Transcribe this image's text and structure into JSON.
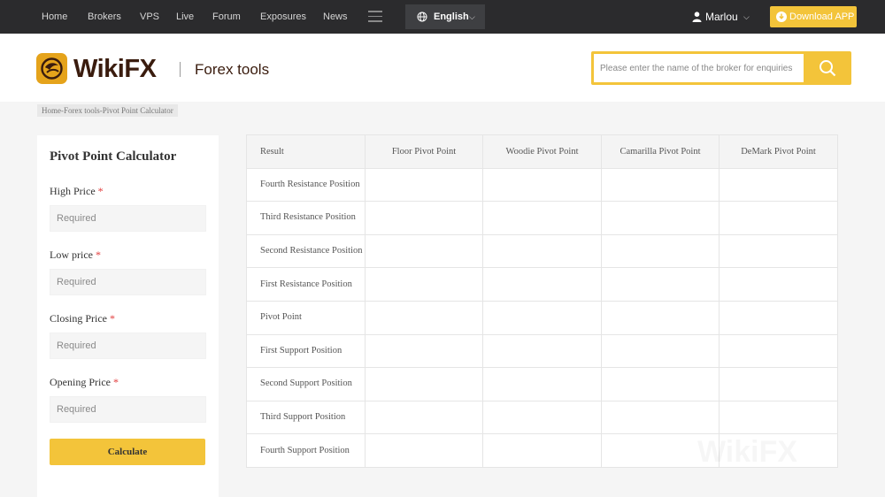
{
  "topnav": {
    "items": [
      "Home",
      "Brokers",
      "VPS",
      "Live",
      "Forum",
      "Exposures",
      "News"
    ],
    "language": "English",
    "user_name": "Marlou",
    "download_label": "Download APP"
  },
  "header": {
    "logo_text": "WikiFX",
    "subtitle": "Forex tools",
    "search_placeholder": "Please enter the name of the broker for enquiries"
  },
  "breadcrumb": "Home-Forex tools-Pivot Point Calculator",
  "form": {
    "title": "Pivot Point Calculator",
    "fields": [
      {
        "label": "High Price",
        "placeholder": "Required"
      },
      {
        "label": "Low price",
        "placeholder": "Required"
      },
      {
        "label": "Closing Price",
        "placeholder": "Required"
      },
      {
        "label": "Opening Price",
        "placeholder": "Required"
      }
    ],
    "required_mark": "*",
    "button_label": "Calculate"
  },
  "table": {
    "headers": [
      "Result",
      "Floor Pivot Point",
      "Woodie Pivot Point",
      "Camarilla Pivot Point",
      "DeMark Pivot Point"
    ],
    "rows": [
      "Fourth Resistance Position",
      "Third Resistance Position",
      "Second Resistance Position",
      "First Resistance Position",
      "Pivot Point",
      "First Support Position",
      "Second Support Position",
      "Third Support Position",
      "Fourth Support Position"
    ]
  },
  "colors": {
    "accent": "#f3c43a",
    "topbar": "#2b2b2d",
    "logo_text": "#3a1c0e",
    "required": "#e13a3a"
  },
  "icons": [
    "menu-icon",
    "globe-icon",
    "chevron-down-icon",
    "user-icon",
    "download-icon",
    "search-icon",
    "wikifx-logo-icon"
  ]
}
